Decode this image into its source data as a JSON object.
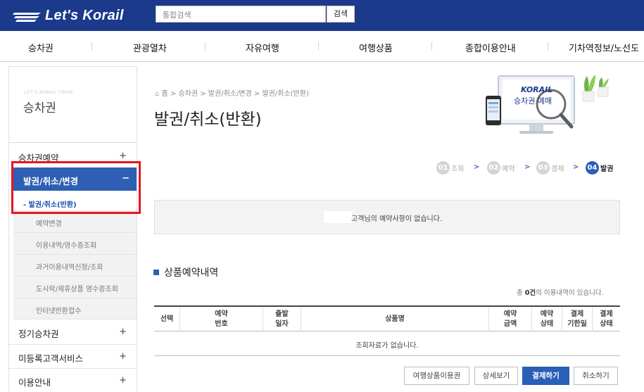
{
  "header": {
    "logo_text": "Let's Korail",
    "search_placeholder": "통합검색",
    "search_button": "검색"
  },
  "gnb": [
    "승차권",
    "관광열차",
    "자유여행",
    "여행상품",
    "종합이용안내",
    "기차역정보/노선도"
  ],
  "sidebar": {
    "eng_title": "LET'S KORAIL TRAIN",
    "title": "승차권",
    "menu": {
      "reserve": "승차권예약",
      "issue_cancel": "발권/취소/변경",
      "season": "정기승차권",
      "guest": "미등록고객서비스",
      "guide": "이용안내"
    },
    "submenu": {
      "active": "- 발권/취소(반환)",
      "items": [
        "예약변경",
        "이용내역/영수증조회",
        "과거이용내역신청/조회",
        "도시락/제휴상품 영수증조회",
        "인터넷반환접수"
      ]
    }
  },
  "breadcrumb": "홈 > 승차권 > 발권/취소/변경 > 발권/취소(반환)",
  "page_title": "발권/취소(반환)",
  "banner": {
    "brand": "KORAIL",
    "label": "승차권 예매"
  },
  "steps": [
    {
      "num": "01",
      "label": "조회"
    },
    {
      "num": "02",
      "label": "예약"
    },
    {
      "num": "03",
      "label": "결제"
    },
    {
      "num": "04",
      "label": "발권"
    }
  ],
  "notice": "고객님의 예약사항이 없습니다.",
  "section": {
    "title": "상품예약내역",
    "count_prefix": "총",
    "count": "0건",
    "count_suffix": "의 이용내역이 있습니다."
  },
  "table": {
    "headers": [
      "선택",
      "예약\n번호",
      "출발\n일자",
      "상품명",
      "예약\n금액",
      "예약\n상태",
      "결제\n기한일",
      "결제\n상태"
    ],
    "empty": "조회자료가 없습니다."
  },
  "buttons": {
    "voucher": "여행상품이용권",
    "detail": "상세보기",
    "pay": "결제하기",
    "cancel": "취소하기"
  }
}
